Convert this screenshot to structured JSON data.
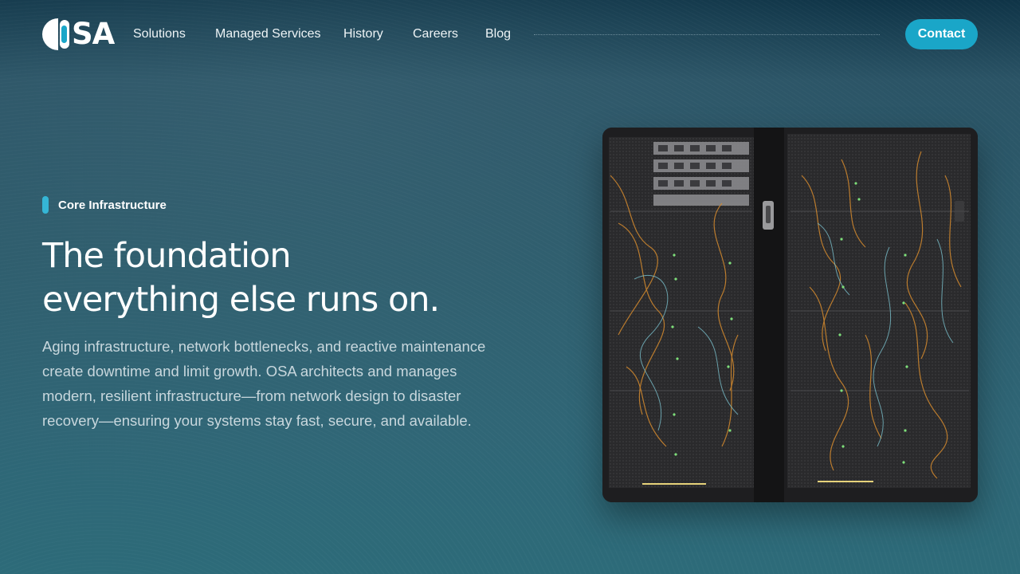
{
  "brand": {
    "logo_text": "SA",
    "logo_alt": "OSA",
    "accent_color": "#1aa6c8"
  },
  "nav": {
    "links": [
      "Solutions",
      "Managed Services",
      "History",
      "Careers",
      "Blog"
    ],
    "contact_label": "Contact"
  },
  "hero": {
    "eyebrow": "Core Infrastructure",
    "headline_line1": "The foundation",
    "headline_line2": "everything else runs on.",
    "body": "Aging infrastructure, network bottlenecks, and reactive maintenance create downtime and limit growth. OSA architects and manages modern, resilient infrastructure—from network design to disaster recovery—ensuring your systems stay fast, secure, and available.",
    "image_icon": "server-rack-photo"
  }
}
